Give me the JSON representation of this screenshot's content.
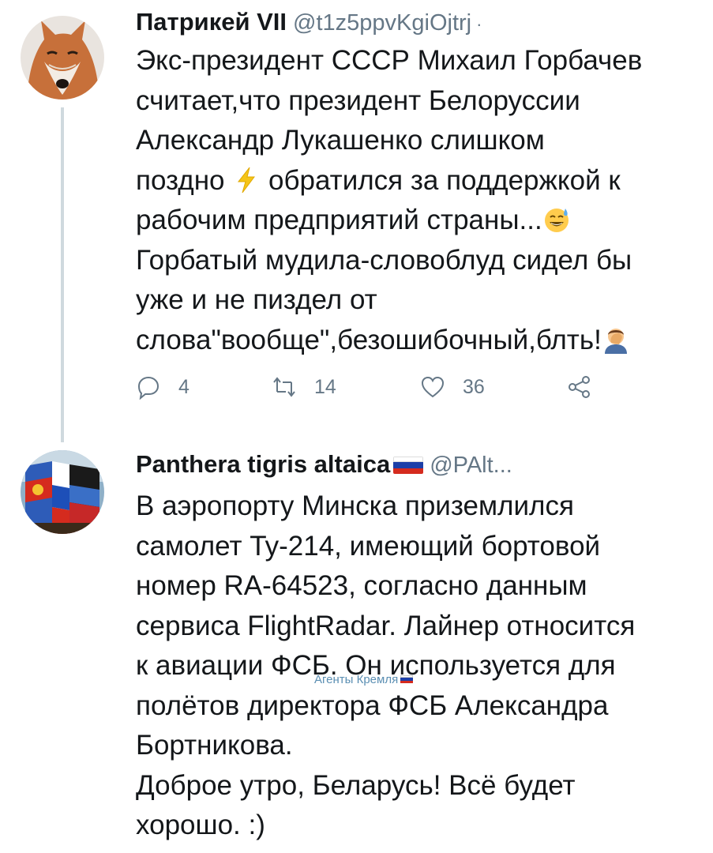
{
  "tweets": [
    {
      "display_name": "Патрикей VII",
      "handle": "@t1z5ppvKgiOjtrj",
      "separator": "·",
      "avatar": "fox-avatar",
      "lines": [
        {
          "text": "Экс-президент СССР Михаил Горбачев"
        },
        {
          "text": "считает,что президент Белоруссии"
        },
        {
          "text": "Александр Лукашенко слишком"
        },
        {
          "text": "поздно",
          "emoji": "lightning-emoji",
          "after": "обратился за поддержкой к"
        },
        {
          "text": "рабочим предприятий страны...",
          "emoji": "sweat-smile-emoji"
        },
        {
          "text": "Горбатый мудила-словоблуд сидел бы"
        },
        {
          "text": "уже и не пиздел от"
        },
        {
          "text": "слова\"вообще\",безошибочный,блть!",
          "emoji": "facepalm-emoji"
        }
      ],
      "actions": {
        "replies": "4",
        "retweets": "14",
        "likes": "36"
      }
    },
    {
      "display_name": "Panthera tigris altaica",
      "handle": "@PAlt...",
      "avatar": "flags-avatar",
      "lines": [
        {
          "text": "В аэропорту Минска приземлился"
        },
        {
          "text": "самолет Ту-214, имеющий бортовой"
        },
        {
          "text": "номер RA-64523, согласно данным"
        },
        {
          "text": "сервиса FlightRadar. Лайнер относится"
        },
        {
          "text": "к авиации ФСБ. Он используется для"
        },
        {
          "text": "полётов директора ФСБ Александра"
        },
        {
          "text": "Бортникова."
        },
        {
          "text": "Доброе утро, Беларусь! Всё будет"
        },
        {
          "text": "хорошо. :)"
        }
      ]
    }
  ],
  "watermark": "Агенты Кремля",
  "colors": {
    "text": "#14171a",
    "secondary": "#657786",
    "thread_line": "#cfd9de",
    "watermark": "#5b8fb3"
  }
}
